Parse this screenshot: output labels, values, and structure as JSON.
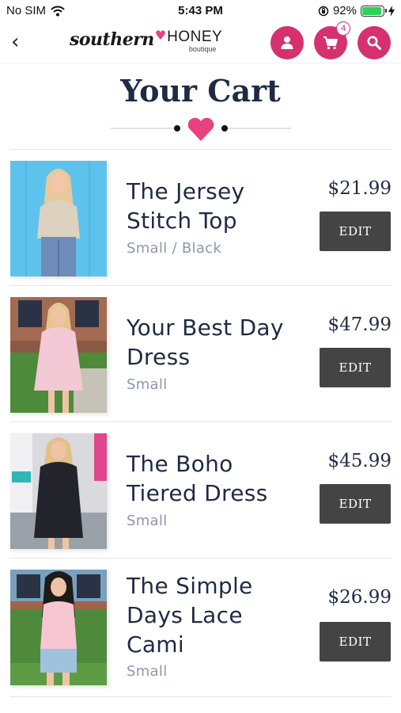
{
  "status_bar": {
    "carrier": "No SIM",
    "time": "5:43 PM",
    "battery": "92%",
    "battery_level": 0.92
  },
  "header": {
    "logo": {
      "southern": "southern",
      "honey": "HONEY",
      "boutique": "boutique"
    },
    "cart_count": "4",
    "icons": [
      "back-chevron-icon",
      "user-icon",
      "cart-icon",
      "search-icon"
    ],
    "accent_color": "#d6306f"
  },
  "page": {
    "title": "Your Cart"
  },
  "cart": {
    "items": [
      {
        "name_line1": "The Jersey",
        "name_line2": "Stitch Top",
        "name_line3": "",
        "variant": "Small / Black",
        "price": "$21.99",
        "edit_label": "EDIT"
      },
      {
        "name_line1": "Your Best Day",
        "name_line2": "Dress",
        "name_line3": "",
        "variant": "Small",
        "price": "$47.99",
        "edit_label": "EDIT"
      },
      {
        "name_line1": "The Boho",
        "name_line2": "Tiered Dress",
        "name_line3": "",
        "variant": "Small",
        "price": "$45.99",
        "edit_label": "EDIT"
      },
      {
        "name_line1": "The Simple",
        "name_line2": "Days Lace",
        "name_line3": "Cami",
        "variant": "Small",
        "price": "$26.99",
        "edit_label": "EDIT"
      }
    ]
  }
}
